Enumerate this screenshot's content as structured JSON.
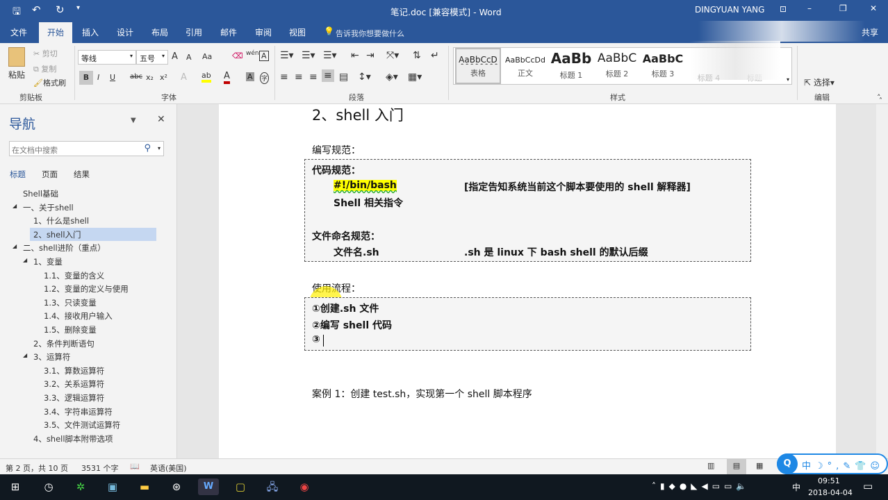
{
  "window": {
    "title": "笔记.doc [兼容模式] - Word",
    "user": "DINGYUAN YANG",
    "ribbon_display_icon": "ribbon-display-icon",
    "minimize": "–",
    "restore": "❐",
    "close": "✕"
  },
  "qat": {
    "save": "save-icon",
    "undo": "undo-icon",
    "redo": "redo-icon",
    "customize": "customize-icon"
  },
  "tabs": [
    "文件",
    "开始",
    "插入",
    "设计",
    "布局",
    "引用",
    "邮件",
    "审阅",
    "视图"
  ],
  "tell_me": "告诉我你想要做什么",
  "share": "共享",
  "clipboard": {
    "paste": "粘贴",
    "cut": "剪切",
    "copy": "复制",
    "format_painter": "格式刷",
    "label": "剪贴板"
  },
  "font": {
    "name": "等线",
    "size": "五号",
    "label": "字体",
    "bold": "B",
    "italic": "I",
    "underline": "U",
    "strike": "abc",
    "sub": "x₂",
    "sup": "x²",
    "case": "Aa",
    "grow": "A",
    "shrink": "A",
    "phonetic": "wén",
    "border": "A",
    "shading": "A",
    "enclose": "字",
    "highlight_color": "#ffff00",
    "font_color": "#c00000"
  },
  "paragraph": {
    "label": "段落"
  },
  "styles": {
    "label": "样式",
    "items": [
      {
        "preview": "AaBbCcD",
        "name": "表格"
      },
      {
        "preview": "AaBbCcDd",
        "name": "正文"
      },
      {
        "preview": "AaBb",
        "name": "标题 1"
      },
      {
        "preview": "AaBbC",
        "name": "标题 2"
      },
      {
        "preview": "AaBbC",
        "name": "标题 3"
      },
      {
        "preview": "",
        "name": "标题 4"
      },
      {
        "preview": "",
        "name": "标题"
      }
    ]
  },
  "editing": {
    "select": "选择",
    "label": "编辑"
  },
  "nav": {
    "title": "导航",
    "search_placeholder": "在文档中搜索",
    "tabs": [
      "标题",
      "页面",
      "结果"
    ],
    "items": [
      {
        "label": "Shell基础",
        "level": 0,
        "expand": ""
      },
      {
        "label": "一、关于shell",
        "level": 0,
        "expand": "◢"
      },
      {
        "label": "1、什么是shell",
        "level": 1,
        "expand": ""
      },
      {
        "label": "2、shell入门",
        "level": 1,
        "expand": "",
        "selected": true
      },
      {
        "label": "二、shell进阶（重点）",
        "level": 0,
        "expand": "◢"
      },
      {
        "label": "1、变量",
        "level": 1,
        "expand": "◢"
      },
      {
        "label": "1.1、变量的含义",
        "level": 2,
        "expand": ""
      },
      {
        "label": "1.2、变量的定义与使用",
        "level": 2,
        "expand": ""
      },
      {
        "label": "1.3、只读变量",
        "level": 2,
        "expand": ""
      },
      {
        "label": "1.4、接收用户输入",
        "level": 2,
        "expand": ""
      },
      {
        "label": "1.5、删除变量",
        "level": 2,
        "expand": ""
      },
      {
        "label": "2、条件判断语句",
        "level": 1,
        "expand": ""
      },
      {
        "label": "3、运算符",
        "level": 1,
        "expand": "◢"
      },
      {
        "label": "3.1、算数运算符",
        "level": 2,
        "expand": ""
      },
      {
        "label": "3.2、关系运算符",
        "level": 2,
        "expand": ""
      },
      {
        "label": "3.3、逻辑运算符",
        "level": 2,
        "expand": ""
      },
      {
        "label": "3.4、字符串运算符",
        "level": 2,
        "expand": ""
      },
      {
        "label": "3.5、文件测试运算符",
        "level": 2,
        "expand": ""
      },
      {
        "label": "4、shell脚本附带选项",
        "level": 1,
        "expand": ""
      }
    ]
  },
  "doc": {
    "heading": "2、shell 入门",
    "write_spec": "编写规范：",
    "code_spec": "代码规范：",
    "shebang": "#!/bin/bash",
    "shebang_note": "[指定告知系统当前这个脚本要使用的 shell 解释器]",
    "shell_cmds": "Shell 相关指令",
    "file_spec": "文件命名规范：",
    "file_name": "文件名.sh",
    "file_note": ".sh 是 linux 下 bash shell  的默认后缀",
    "flow": "使用流程：",
    "step1": "①创建.sh 文件",
    "step2": "②编写 shell 代码",
    "step3": "③",
    "case1": "案例 1：创建 test.sh，实现第一个 shell 脚本程序"
  },
  "status": {
    "page": "第 2 页，共 10 页",
    "words": "3531 个字",
    "lang": "英语(美国)"
  },
  "ime": {
    "items": [
      "中",
      "☽",
      "°,",
      "✎",
      "👕",
      "☺"
    ]
  },
  "taskbar": {
    "time": "09:51",
    "date": "2018-04-04",
    "ime": "中"
  }
}
